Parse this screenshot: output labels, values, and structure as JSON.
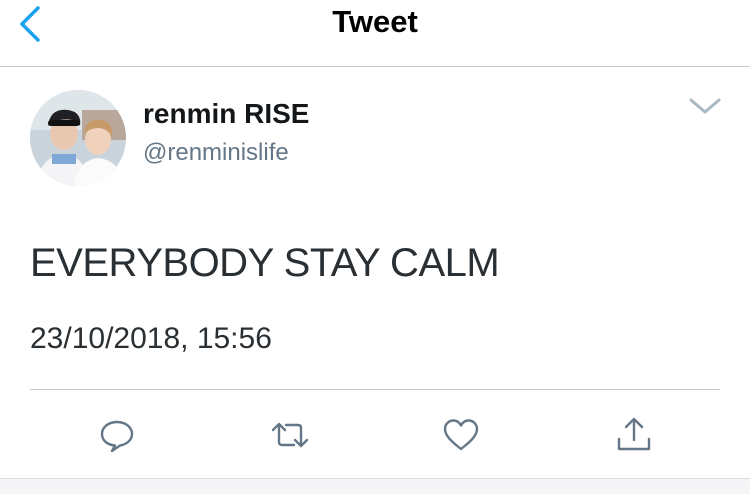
{
  "nav": {
    "title": "Tweet",
    "back_icon": "chevron-left-icon",
    "accent_color": "#1da1f2"
  },
  "tweet": {
    "display_name": "renmin RISE",
    "handle": "@renminislife",
    "text": "EVERYBODY STAY CALM",
    "timestamp": "23/10/2018, 15:56",
    "more_icon": "chevron-down-icon"
  },
  "actions": [
    {
      "icon": "reply-icon"
    },
    {
      "icon": "retweet-icon"
    },
    {
      "icon": "like-icon"
    },
    {
      "icon": "share-icon"
    }
  ],
  "colors": {
    "text_primary": "#14171a",
    "text_secondary": "#657786",
    "divider": "#c8c7cc",
    "icon_gray": "#657786"
  }
}
